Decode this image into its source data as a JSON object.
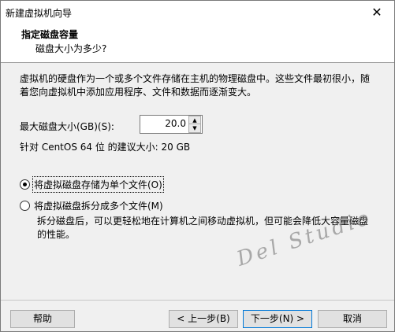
{
  "window": {
    "title": "新建虚拟机向导",
    "close_glyph": "✕"
  },
  "header": {
    "title": "指定磁盘容量",
    "subtitle": "磁盘大小为多少?"
  },
  "body": {
    "description": "虚拟机的硬盘作为一个或多个文件存储在主机的物理磁盘中。这些文件最初很小，随着您向虚拟机中添加应用程序、文件和数据而逐渐变大。",
    "disk_size_label": "最大磁盘大小(GB)(S):",
    "disk_size_value": "20.0",
    "recommended": "针对 CentOS 64 位 的建议大小: 20 GB",
    "radio_single": {
      "label": "将虚拟磁盘存储为单个文件(O)",
      "checked": true
    },
    "radio_multi": {
      "label": "将虚拟磁盘拆分成多个文件(M)",
      "checked": false
    },
    "multi_description": "拆分磁盘后，可以更轻松地在计算机之间移动虚拟机，但可能会降低大容量磁盘的性能。",
    "watermark": "Del Studio"
  },
  "footer": {
    "help": "帮助",
    "back": "< 上一步(B)",
    "next": "下一步(N) >",
    "cancel": "取消"
  }
}
